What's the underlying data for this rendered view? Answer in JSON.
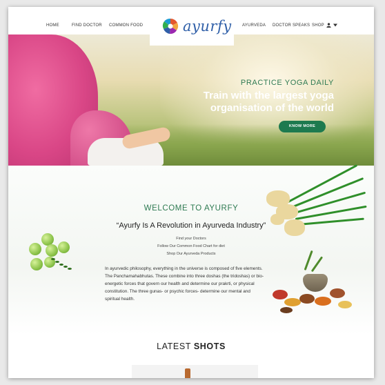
{
  "nav": {
    "left_items": [
      "HOME",
      "FIND DOCTOR",
      "COMMON FOOD"
    ],
    "right_items": [
      "AYURVEDA",
      "DOCTOR SPEAKS"
    ],
    "shop_label": "SHOP",
    "logo_text": "ayurfy"
  },
  "hero": {
    "subtitle": "PRACTICE YOGA DAILY",
    "title": "Train with the largest yoga organisation of the world",
    "button_label": "KNOW MORE"
  },
  "welcome": {
    "title": "WELCOME TO AYURFY",
    "quote": "“Ayurfy Is A Revolution in Ayurveda Industry”",
    "links": [
      "Find your Doctors",
      "Follow Our Common Food Chart for diet",
      "Shop Our Ayurveda Products"
    ],
    "paragraph": "In ayurvedic philosophy, everything in the universe is composed of five elements. The Panchamahabhutas. These combine into three doshas (the tridoshas) or bio-energetic forces that govern our health and determine our prakrti, or physical constitution. The three gunas- or psychic forces- determine our mental and spiritual health."
  },
  "latest": {
    "title_light": "LATEST",
    "title_bold": "SHOTS"
  },
  "icons": {
    "user": "user-icon",
    "caret": "caret-down-icon",
    "logo": "ayurfy-logo-icon"
  },
  "colors": {
    "brand_green": "#1d7a4f",
    "heading_green": "#2e7a52",
    "logo_blue": "#2f5fa8"
  }
}
